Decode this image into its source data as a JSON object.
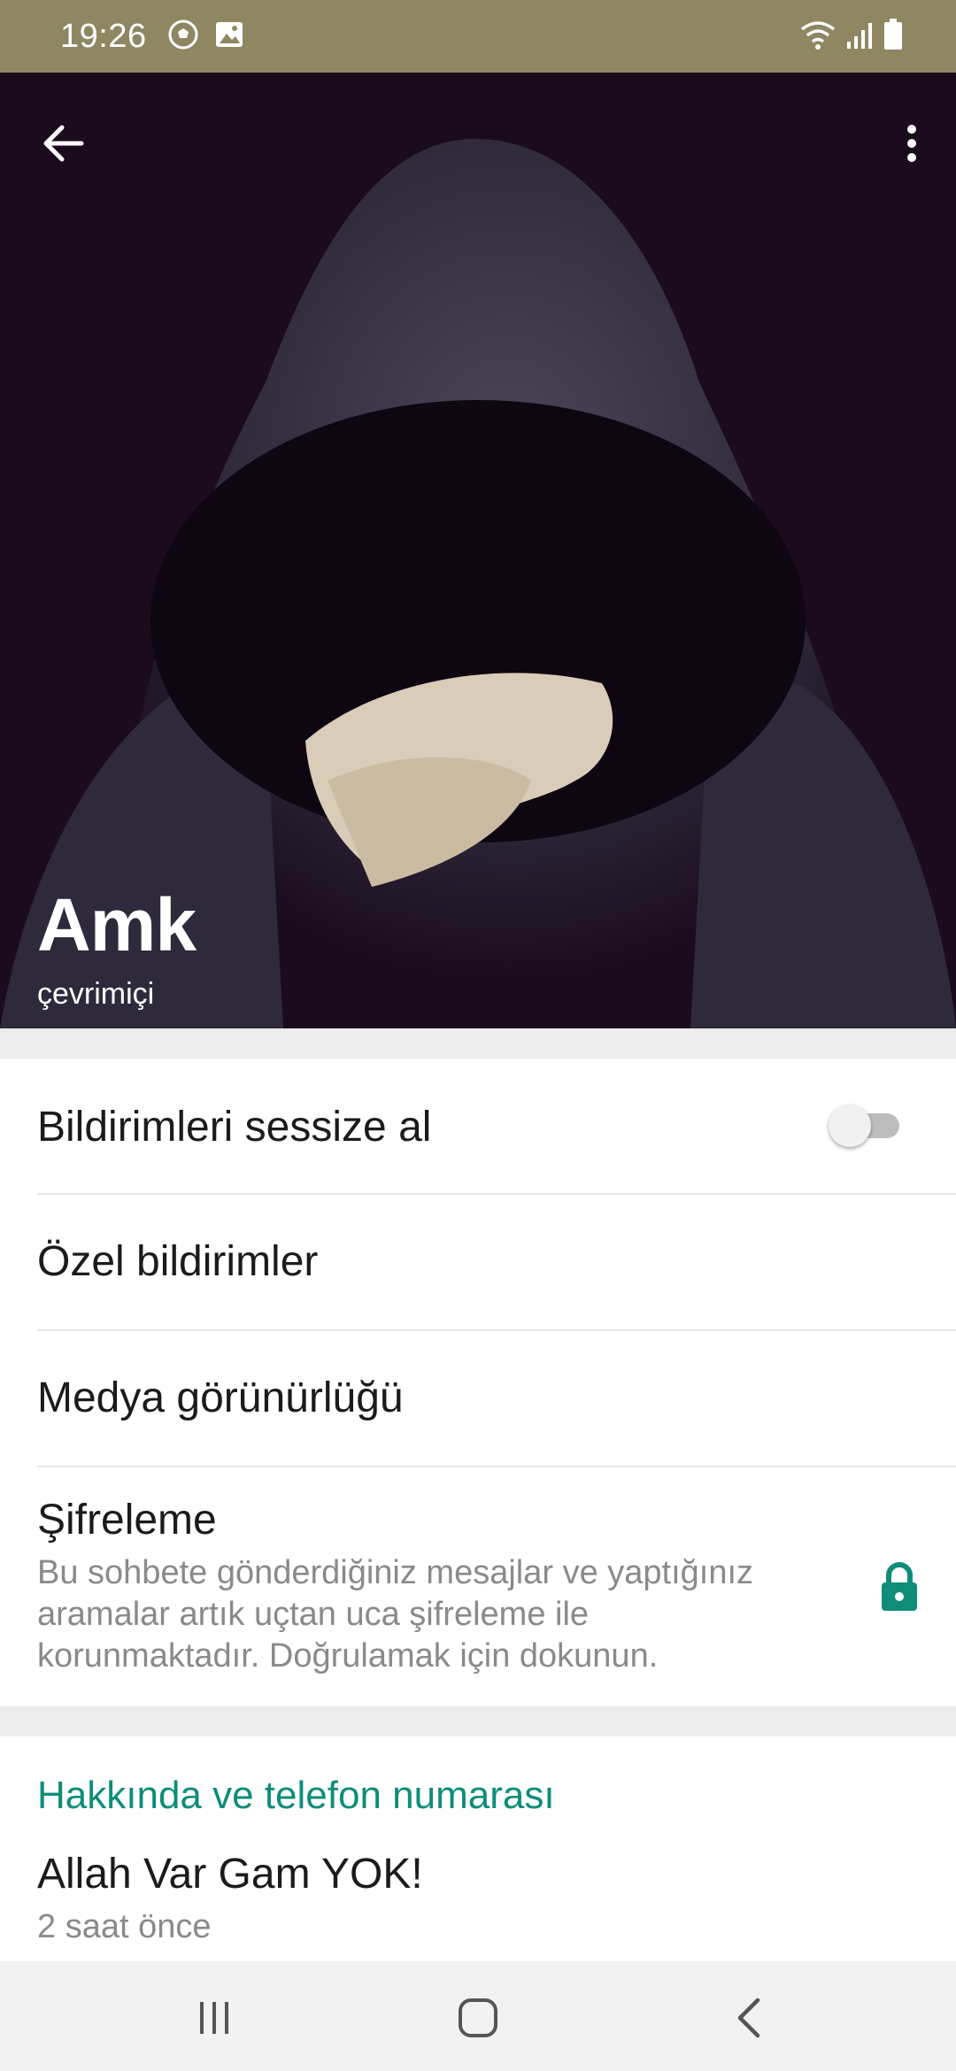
{
  "status_bar": {
    "time": "19:26",
    "left_icons": [
      "soccer-ball-icon",
      "image-icon"
    ],
    "right_icons": [
      "wifi-icon",
      "signal-icon",
      "battery-icon"
    ],
    "background": "#8f8762"
  },
  "profile": {
    "name": "Amk",
    "presence": "çevrimiçi",
    "photo": "hooded-figure-profile-photo"
  },
  "settings": {
    "mute_label": "Bildirimleri sessize al",
    "mute_enabled": false,
    "custom_notifications_label": "Özel bildirimler",
    "media_visibility_label": "Medya görünürlüğü",
    "encryption_title": "Şifreleme",
    "encryption_description": "Bu sohbete gönderdiğiniz mesajlar ve yaptığınız aramalar artık uçtan uca şifreleme ile korunmaktadır. Doğrulamak için dokunun."
  },
  "about": {
    "section_title": "Hakkında ve telefon numarası",
    "status_text": "Allah Var Gam YOK!",
    "status_time": "2 saat önce"
  },
  "colors": {
    "accent": "#0f8d79",
    "lock": "#0f8d79"
  },
  "nav_bar": {
    "buttons": [
      "recent-apps-icon",
      "home-icon",
      "back-icon"
    ]
  }
}
